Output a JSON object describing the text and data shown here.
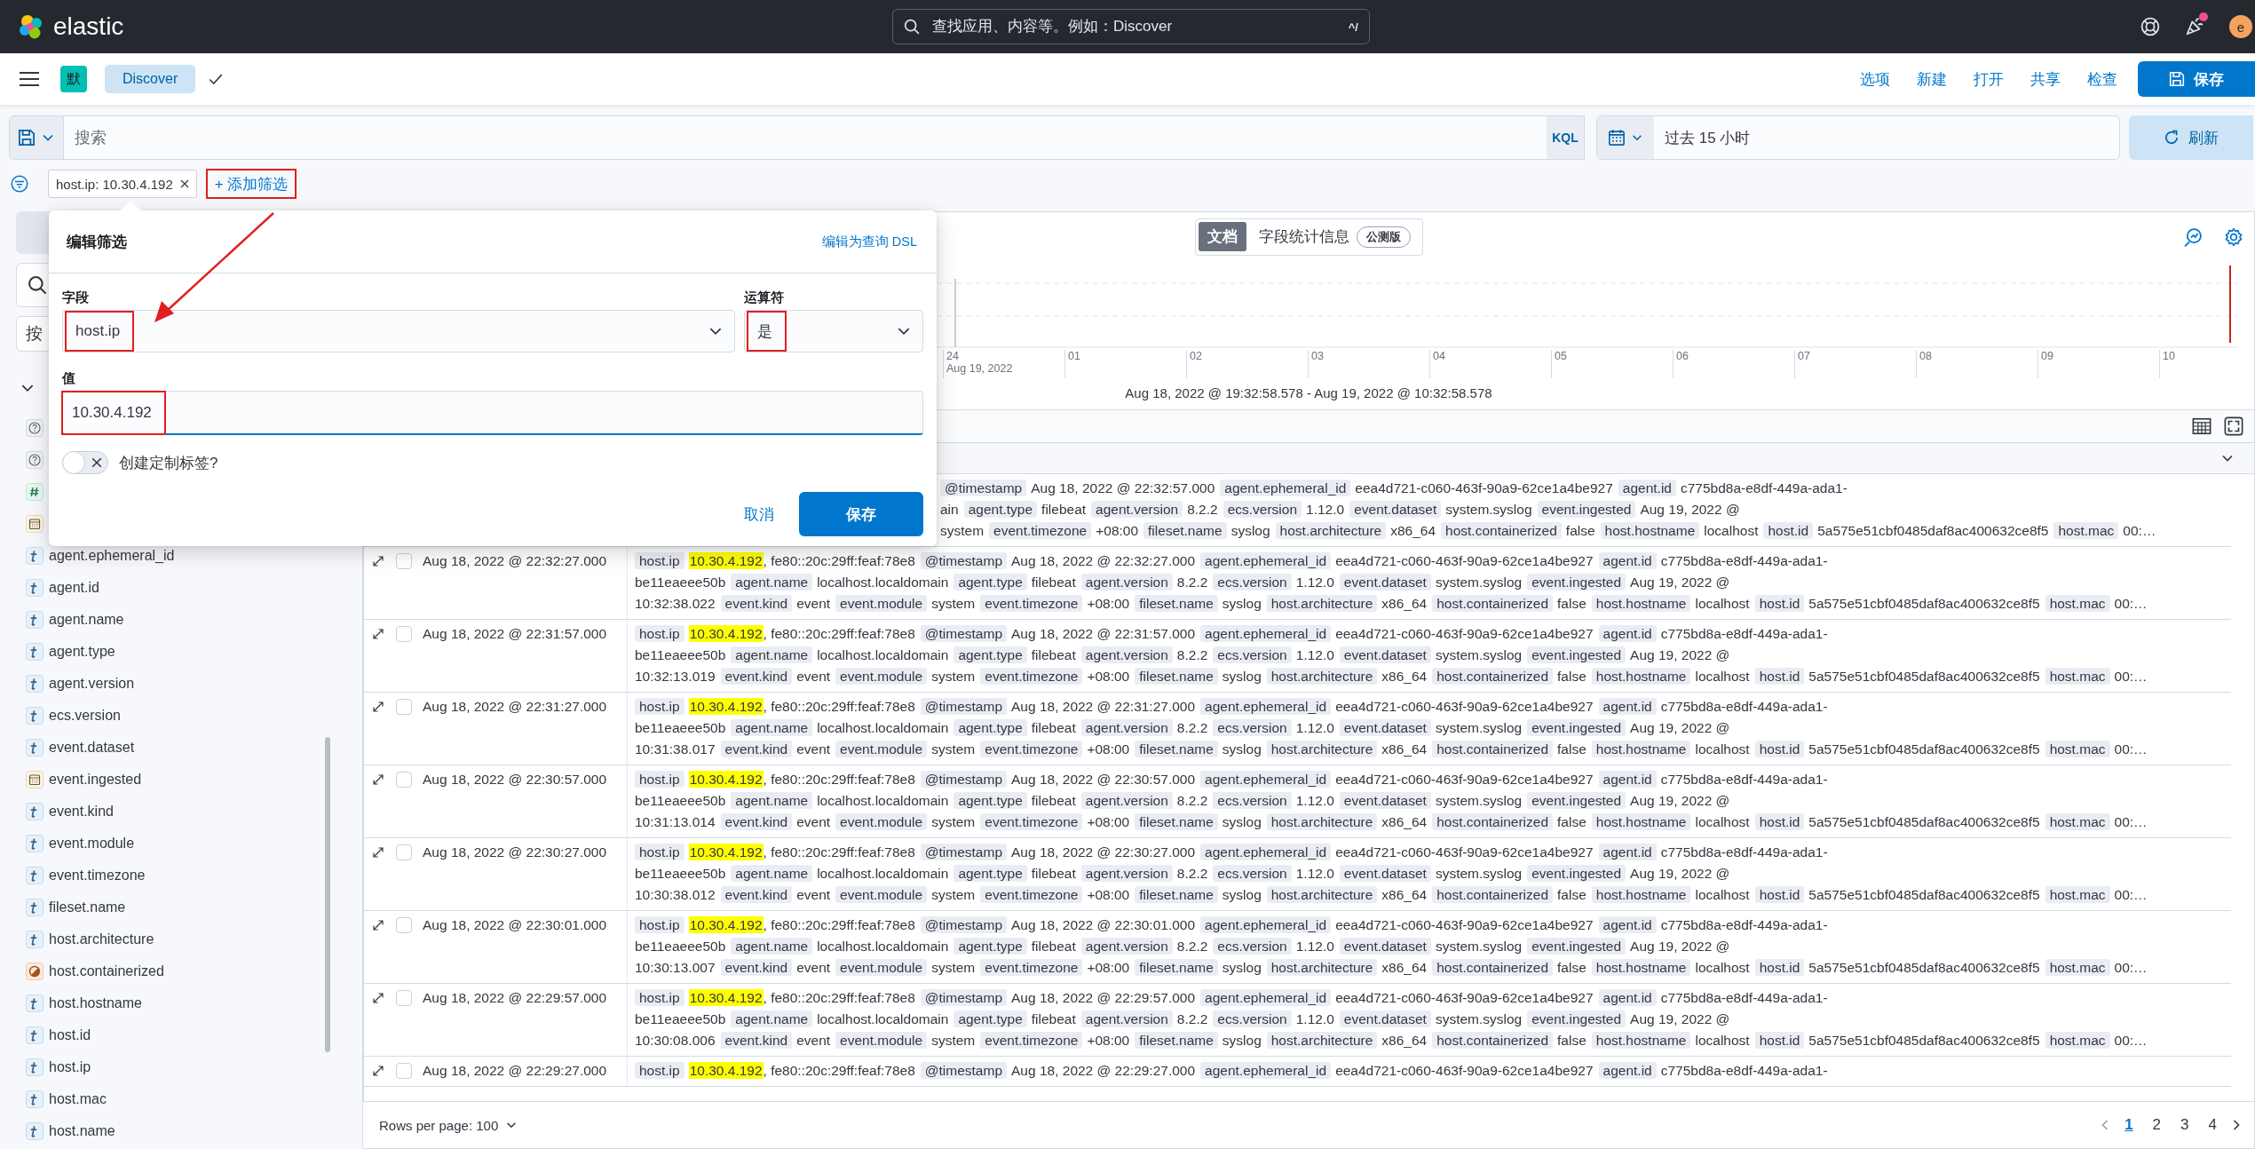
{
  "header": {
    "logo_text": "elastic",
    "search": {
      "placeholder": "查找应用、内容等。例如：Discover",
      "shortcut": "^/"
    },
    "has_notification": true,
    "avatar_initial": "e"
  },
  "app_bar": {
    "space_initial": "默",
    "breadcrumb": "Discover",
    "actions": [
      "选项",
      "新建",
      "打开",
      "共享",
      "检查"
    ],
    "save_button": "保存"
  },
  "query_bar": {
    "placeholder": "搜索",
    "language": "KQL",
    "time_range": "过去 15 小时",
    "refresh_button": "刷新"
  },
  "filters": [
    {
      "label": "host.ip: 10.30.4.192"
    }
  ],
  "add_filter": {
    "label": "+ 添加筛选",
    "annotated": true
  },
  "sidebar": {
    "type_filter": "按",
    "fields": [
      {
        "kind": "unknown"
      },
      {
        "kind": "unknown"
      },
      {
        "kind": "number"
      },
      {
        "kind": "date"
      },
      {
        "kind": "string",
        "name": "agent.ephemeral_id"
      },
      {
        "kind": "string",
        "name": "agent.id"
      },
      {
        "kind": "string",
        "name": "agent.name"
      },
      {
        "kind": "string",
        "name": "agent.type"
      },
      {
        "kind": "string",
        "name": "agent.version"
      },
      {
        "kind": "string",
        "name": "ecs.version"
      },
      {
        "kind": "string",
        "name": "event.dataset"
      },
      {
        "kind": "date",
        "name": "event.ingested"
      },
      {
        "kind": "string",
        "name": "event.kind"
      },
      {
        "kind": "string",
        "name": "event.module"
      },
      {
        "kind": "string",
        "name": "event.timezone"
      },
      {
        "kind": "string",
        "name": "fileset.name"
      },
      {
        "kind": "string",
        "name": "host.architecture"
      },
      {
        "kind": "boolean",
        "name": "host.containerized"
      },
      {
        "kind": "string",
        "name": "host.hostname"
      },
      {
        "kind": "string",
        "name": "host.id"
      },
      {
        "kind": "string",
        "name": "host.ip"
      },
      {
        "kind": "string",
        "name": "host.mac"
      },
      {
        "kind": "string",
        "name": "host.name"
      }
    ]
  },
  "view_tabs": [
    {
      "label": "文档",
      "selected": true
    },
    {
      "label": "字段统计信息",
      "badge": "公测版",
      "selected": false
    }
  ],
  "chart": {
    "x_labels": [
      {
        "label": "24",
        "sublabel": "Aug 19, 2022"
      },
      {
        "label": "01"
      },
      {
        "label": "02"
      },
      {
        "label": "03"
      },
      {
        "label": "04"
      },
      {
        "label": "05"
      },
      {
        "label": "06"
      },
      {
        "label": "07"
      },
      {
        "label": "08"
      },
      {
        "label": "09"
      },
      {
        "label": "10"
      }
    ],
    "time_range": "Aug 18, 2022 @ 19:32:58.578 - Aug 19, 2022 @ 10:32:58.578"
  },
  "documents": [
    {
      "kind": "partial",
      "lines": [
        [
          {
            "key": "@timestamp",
            "value": "Aug 18, 2022 @ 22:32:57.000"
          },
          {
            "key": "agent.ephemeral_id",
            "value": "eea4d721-c060-463f-90a9-62ce1a4be927"
          },
          {
            "key": "agent.id",
            "value": "c775bd8a-e8df-449a-ada1-"
          }
        ],
        [
          {
            "value": "ain"
          },
          {
            "key": "agent.type",
            "value": "filebeat"
          },
          {
            "key": "agent.version",
            "value": "8.2.2"
          },
          {
            "key": "ecs.version",
            "value": "1.12.0"
          },
          {
            "key": "event.dataset",
            "value": "system.syslog"
          },
          {
            "key": "event.ingested",
            "value": "Aug 19, 2022 @"
          }
        ],
        [
          {
            "value": "system"
          },
          {
            "key": "event.timezone",
            "value": "+08:00"
          },
          {
            "key": "fileset.name",
            "value": "syslog"
          },
          {
            "key": "host.architecture",
            "value": "x86_64"
          },
          {
            "key": "host.containerized",
            "value": "false"
          },
          {
            "key": "host.hostname",
            "value": "localhost"
          },
          {
            "key": "host.id",
            "value": "5a575e51cbf0485daf8ac400632ce8f5"
          },
          {
            "key": "host.mac",
            "value": "00:…"
          }
        ]
      ]
    },
    {
      "kind": "full",
      "timestamp": "Aug 18, 2022 @ 22:32:27.000",
      "selected": false,
      "lines": [
        [
          {
            "key": "host.ip",
            "highlight": "10.30.4.192",
            "value": ", fe80::20c:29ff:feaf:78e8"
          },
          {
            "key": "@timestamp",
            "value": "Aug 18, 2022 @ 22:32:27.000"
          },
          {
            "key": "agent.ephemeral_id",
            "value": "eea4d721-c060-463f-90a9-62ce1a4be927"
          },
          {
            "key": "agent.id",
            "value": "c775bd8a-e8df-449a-ada1-"
          }
        ],
        [
          {
            "value": "be11eaeee50b"
          },
          {
            "key": "agent.name",
            "value": "localhost.localdomain"
          },
          {
            "key": "agent.type",
            "value": "filebeat"
          },
          {
            "key": "agent.version",
            "value": "8.2.2"
          },
          {
            "key": "ecs.version",
            "value": "1.12.0"
          },
          {
            "key": "event.dataset",
            "value": "system.syslog"
          },
          {
            "key": "event.ingested",
            "value": "Aug 19, 2022 @"
          }
        ],
        [
          {
            "value": "10:32:38.022"
          },
          {
            "key": "event.kind",
            "value": "event"
          },
          {
            "key": "event.module",
            "value": "system"
          },
          {
            "key": "event.timezone",
            "value": "+08:00"
          },
          {
            "key": "fileset.name",
            "value": "syslog"
          },
          {
            "key": "host.architecture",
            "value": "x86_64"
          },
          {
            "key": "host.containerized",
            "value": "false"
          },
          {
            "key": "host.hostname",
            "value": "localhost"
          },
          {
            "key": "host.id",
            "value": "5a575e51cbf0485daf8ac400632ce8f5"
          },
          {
            "key": "host.mac",
            "value": "00:…"
          }
        ]
      ]
    },
    {
      "kind": "full",
      "timestamp": "Aug 18, 2022 @ 22:31:57.000",
      "selected": false,
      "lines": [
        [
          {
            "key": "host.ip",
            "highlight": "10.30.4.192",
            "value": ", fe80::20c:29ff:feaf:78e8"
          },
          {
            "key": "@timestamp",
            "value": "Aug 18, 2022 @ 22:31:57.000"
          },
          {
            "key": "agent.ephemeral_id",
            "value": "eea4d721-c060-463f-90a9-62ce1a4be927"
          },
          {
            "key": "agent.id",
            "value": "c775bd8a-e8df-449a-ada1-"
          }
        ],
        [
          {
            "value": "be11eaeee50b"
          },
          {
            "key": "agent.name",
            "value": "localhost.localdomain"
          },
          {
            "key": "agent.type",
            "value": "filebeat"
          },
          {
            "key": "agent.version",
            "value": "8.2.2"
          },
          {
            "key": "ecs.version",
            "value": "1.12.0"
          },
          {
            "key": "event.dataset",
            "value": "system.syslog"
          },
          {
            "key": "event.ingested",
            "value": "Aug 19, 2022 @"
          }
        ],
        [
          {
            "value": "10:32:13.019"
          },
          {
            "key": "event.kind",
            "value": "event"
          },
          {
            "key": "event.module",
            "value": "system"
          },
          {
            "key": "event.timezone",
            "value": "+08:00"
          },
          {
            "key": "fileset.name",
            "value": "syslog"
          },
          {
            "key": "host.architecture",
            "value": "x86_64"
          },
          {
            "key": "host.containerized",
            "value": "false"
          },
          {
            "key": "host.hostname",
            "value": "localhost"
          },
          {
            "key": "host.id",
            "value": "5a575e51cbf0485daf8ac400632ce8f5"
          },
          {
            "key": "host.mac",
            "value": "00:…"
          }
        ]
      ]
    },
    {
      "kind": "full",
      "timestamp": "Aug 18, 2022 @ 22:31:27.000",
      "selected": false,
      "lines": [
        [
          {
            "key": "host.ip",
            "highlight": "10.30.4.192",
            "value": ", fe80::20c:29ff:feaf:78e8"
          },
          {
            "key": "@timestamp",
            "value": "Aug 18, 2022 @ 22:31:27.000"
          },
          {
            "key": "agent.ephemeral_id",
            "value": "eea4d721-c060-463f-90a9-62ce1a4be927"
          },
          {
            "key": "agent.id",
            "value": "c775bd8a-e8df-449a-ada1-"
          }
        ],
        [
          {
            "value": "be11eaeee50b"
          },
          {
            "key": "agent.name",
            "value": "localhost.localdomain"
          },
          {
            "key": "agent.type",
            "value": "filebeat"
          },
          {
            "key": "agent.version",
            "value": "8.2.2"
          },
          {
            "key": "ecs.version",
            "value": "1.12.0"
          },
          {
            "key": "event.dataset",
            "value": "system.syslog"
          },
          {
            "key": "event.ingested",
            "value": "Aug 19, 2022 @"
          }
        ],
        [
          {
            "value": "10:31:38.017"
          },
          {
            "key": "event.kind",
            "value": "event"
          },
          {
            "key": "event.module",
            "value": "system"
          },
          {
            "key": "event.timezone",
            "value": "+08:00"
          },
          {
            "key": "fileset.name",
            "value": "syslog"
          },
          {
            "key": "host.architecture",
            "value": "x86_64"
          },
          {
            "key": "host.containerized",
            "value": "false"
          },
          {
            "key": "host.hostname",
            "value": "localhost"
          },
          {
            "key": "host.id",
            "value": "5a575e51cbf0485daf8ac400632ce8f5"
          },
          {
            "key": "host.mac",
            "value": "00:…"
          }
        ]
      ]
    },
    {
      "kind": "full",
      "timestamp": "Aug 18, 2022 @ 22:30:57.000",
      "selected": false,
      "lines": [
        [
          {
            "key": "host.ip",
            "highlight": "10.30.4.192",
            "value": ", fe80::20c:29ff:feaf:78e8"
          },
          {
            "key": "@timestamp",
            "value": "Aug 18, 2022 @ 22:30:57.000"
          },
          {
            "key": "agent.ephemeral_id",
            "value": "eea4d721-c060-463f-90a9-62ce1a4be927"
          },
          {
            "key": "agent.id",
            "value": "c775bd8a-e8df-449a-ada1-"
          }
        ],
        [
          {
            "value": "be11eaeee50b"
          },
          {
            "key": "agent.name",
            "value": "localhost.localdomain"
          },
          {
            "key": "agent.type",
            "value": "filebeat"
          },
          {
            "key": "agent.version",
            "value": "8.2.2"
          },
          {
            "key": "ecs.version",
            "value": "1.12.0"
          },
          {
            "key": "event.dataset",
            "value": "system.syslog"
          },
          {
            "key": "event.ingested",
            "value": "Aug 19, 2022 @"
          }
        ],
        [
          {
            "value": "10:31:13.014"
          },
          {
            "key": "event.kind",
            "value": "event"
          },
          {
            "key": "event.module",
            "value": "system"
          },
          {
            "key": "event.timezone",
            "value": "+08:00"
          },
          {
            "key": "fileset.name",
            "value": "syslog"
          },
          {
            "key": "host.architecture",
            "value": "x86_64"
          },
          {
            "key": "host.containerized",
            "value": "false"
          },
          {
            "key": "host.hostname",
            "value": "localhost"
          },
          {
            "key": "host.id",
            "value": "5a575e51cbf0485daf8ac400632ce8f5"
          },
          {
            "key": "host.mac",
            "value": "00:…"
          }
        ]
      ]
    },
    {
      "kind": "full",
      "timestamp": "Aug 18, 2022 @ 22:30:27.000",
      "selected": false,
      "lines": [
        [
          {
            "key": "host.ip",
            "highlight": "10.30.4.192",
            "value": ", fe80::20c:29ff:feaf:78e8"
          },
          {
            "key": "@timestamp",
            "value": "Aug 18, 2022 @ 22:30:27.000"
          },
          {
            "key": "agent.ephemeral_id",
            "value": "eea4d721-c060-463f-90a9-62ce1a4be927"
          },
          {
            "key": "agent.id",
            "value": "c775bd8a-e8df-449a-ada1-"
          }
        ],
        [
          {
            "value": "be11eaeee50b"
          },
          {
            "key": "agent.name",
            "value": "localhost.localdomain"
          },
          {
            "key": "agent.type",
            "value": "filebeat"
          },
          {
            "key": "agent.version",
            "value": "8.2.2"
          },
          {
            "key": "ecs.version",
            "value": "1.12.0"
          },
          {
            "key": "event.dataset",
            "value": "system.syslog"
          },
          {
            "key": "event.ingested",
            "value": "Aug 19, 2022 @"
          }
        ],
        [
          {
            "value": "10:30:38.012"
          },
          {
            "key": "event.kind",
            "value": "event"
          },
          {
            "key": "event.module",
            "value": "system"
          },
          {
            "key": "event.timezone",
            "value": "+08:00"
          },
          {
            "key": "fileset.name",
            "value": "syslog"
          },
          {
            "key": "host.architecture",
            "value": "x86_64"
          },
          {
            "key": "host.containerized",
            "value": "false"
          },
          {
            "key": "host.hostname",
            "value": "localhost"
          },
          {
            "key": "host.id",
            "value": "5a575e51cbf0485daf8ac400632ce8f5"
          },
          {
            "key": "host.mac",
            "value": "00:…"
          }
        ]
      ]
    },
    {
      "kind": "full",
      "timestamp": "Aug 18, 2022 @ 22:30:01.000",
      "selected": false,
      "lines": [
        [
          {
            "key": "host.ip",
            "highlight": "10.30.4.192",
            "value": ", fe80::20c:29ff:feaf:78e8"
          },
          {
            "key": "@timestamp",
            "value": "Aug 18, 2022 @ 22:30:01.000"
          },
          {
            "key": "agent.ephemeral_id",
            "value": "eea4d721-c060-463f-90a9-62ce1a4be927"
          },
          {
            "key": "agent.id",
            "value": "c775bd8a-e8df-449a-ada1-"
          }
        ],
        [
          {
            "value": "be11eaeee50b"
          },
          {
            "key": "agent.name",
            "value": "localhost.localdomain"
          },
          {
            "key": "agent.type",
            "value": "filebeat"
          },
          {
            "key": "agent.version",
            "value": "8.2.2"
          },
          {
            "key": "ecs.version",
            "value": "1.12.0"
          },
          {
            "key": "event.dataset",
            "value": "system.syslog"
          },
          {
            "key": "event.ingested",
            "value": "Aug 19, 2022 @"
          }
        ],
        [
          {
            "value": "10:30:13.007"
          },
          {
            "key": "event.kind",
            "value": "event"
          },
          {
            "key": "event.module",
            "value": "system"
          },
          {
            "key": "event.timezone",
            "value": "+08:00"
          },
          {
            "key": "fileset.name",
            "value": "syslog"
          },
          {
            "key": "host.architecture",
            "value": "x86_64"
          },
          {
            "key": "host.containerized",
            "value": "false"
          },
          {
            "key": "host.hostname",
            "value": "localhost"
          },
          {
            "key": "host.id",
            "value": "5a575e51cbf0485daf8ac400632ce8f5"
          },
          {
            "key": "host.mac",
            "value": "00:…"
          }
        ]
      ]
    },
    {
      "kind": "full",
      "timestamp": "Aug 18, 2022 @ 22:29:57.000",
      "selected": false,
      "lines": [
        [
          {
            "key": "host.ip",
            "highlight": "10.30.4.192",
            "value": ", fe80::20c:29ff:feaf:78e8"
          },
          {
            "key": "@timestamp",
            "value": "Aug 18, 2022 @ 22:29:57.000"
          },
          {
            "key": "agent.ephemeral_id",
            "value": "eea4d721-c060-463f-90a9-62ce1a4be927"
          },
          {
            "key": "agent.id",
            "value": "c775bd8a-e8df-449a-ada1-"
          }
        ],
        [
          {
            "value": "be11eaeee50b"
          },
          {
            "key": "agent.name",
            "value": "localhost.localdomain"
          },
          {
            "key": "agent.type",
            "value": "filebeat"
          },
          {
            "key": "agent.version",
            "value": "8.2.2"
          },
          {
            "key": "ecs.version",
            "value": "1.12.0"
          },
          {
            "key": "event.dataset",
            "value": "system.syslog"
          },
          {
            "key": "event.ingested",
            "value": "Aug 19, 2022 @"
          }
        ],
        [
          {
            "value": "10:30:08.006"
          },
          {
            "key": "event.kind",
            "value": "event"
          },
          {
            "key": "event.module",
            "value": "system"
          },
          {
            "key": "event.timezone",
            "value": "+08:00"
          },
          {
            "key": "fileset.name",
            "value": "syslog"
          },
          {
            "key": "host.architecture",
            "value": "x86_64"
          },
          {
            "key": "host.containerized",
            "value": "false"
          },
          {
            "key": "host.hostname",
            "value": "localhost"
          },
          {
            "key": "host.id",
            "value": "5a575e51cbf0485daf8ac400632ce8f5"
          },
          {
            "key": "host.mac",
            "value": "00:…"
          }
        ]
      ]
    },
    {
      "kind": "full",
      "timestamp": "Aug 18, 2022 @ 22:29:27.000",
      "selected": false,
      "lines": [
        [
          {
            "key": "host.ip",
            "highlight": "10.30.4.192",
            "value": ", fe80::20c:29ff:feaf:78e8"
          },
          {
            "key": "@timestamp",
            "value": "Aug 18, 2022 @ 22:29:27.000"
          },
          {
            "key": "agent.ephemeral_id",
            "value": "eea4d721-c060-463f-90a9-62ce1a4be927"
          },
          {
            "key": "agent.id",
            "value": "c775bd8a-e8df-449a-ada1-"
          }
        ]
      ]
    }
  ],
  "footer": {
    "rows_per_page": "Rows per page: 100",
    "pages": [
      {
        "label": "1",
        "selected": true
      },
      {
        "label": "2",
        "selected": false
      },
      {
        "label": "3",
        "selected": false
      },
      {
        "label": "4",
        "selected": false
      }
    ]
  },
  "edit_filter": {
    "title": "编辑筛选",
    "dsl_link": "编辑为查询 DSL",
    "field_label": "字段",
    "field": {
      "value": "host.ip",
      "annotated": true
    },
    "operator_label": "运算符",
    "operator": {
      "value": "是",
      "annotated": true
    },
    "value_label": "值",
    "value": {
      "value": "10.30.4.192",
      "annotated": true
    },
    "custom_label": {
      "label": "创建定制标签?",
      "on": false
    },
    "cancel_button": "取消",
    "save_button": "保存"
  }
}
